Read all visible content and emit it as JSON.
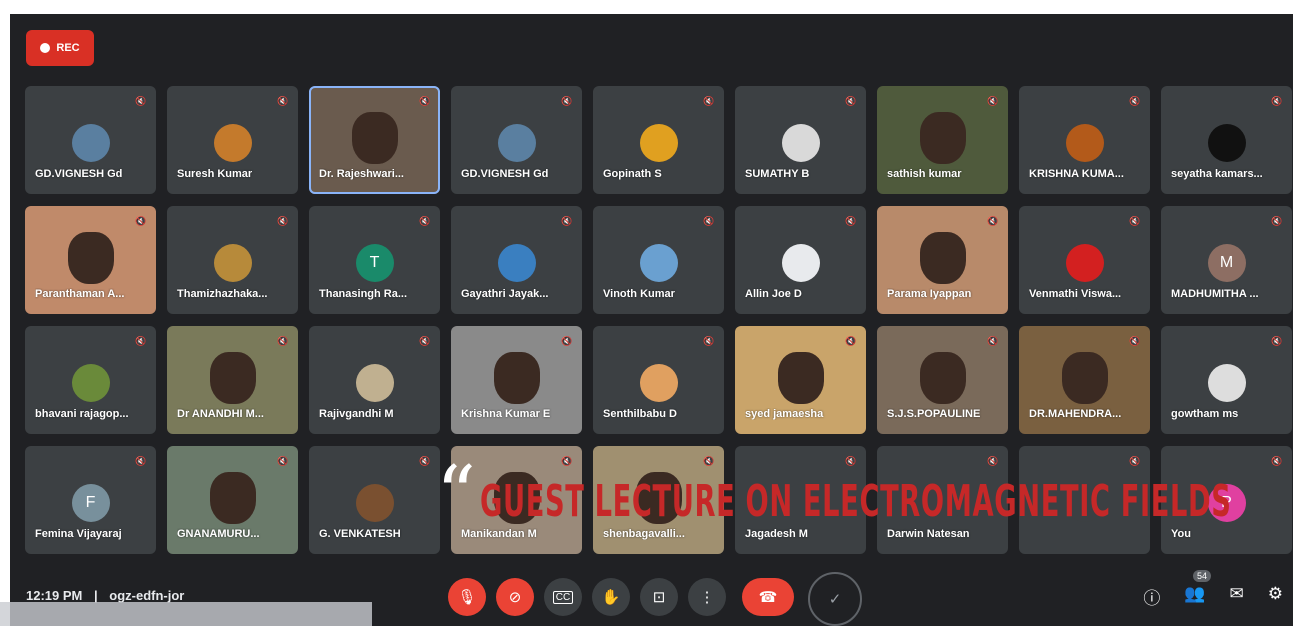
{
  "recording": {
    "label": "REC"
  },
  "tiles": [
    {
      "name": "GD.VIGNESH Gd",
      "type": "avatar",
      "initial": "",
      "color": "#5a7fa0"
    },
    {
      "name": "Suresh Kumar",
      "type": "avatar",
      "initial": "",
      "color": "#c47a2c"
    },
    {
      "name": "Dr. Rajeshwari...",
      "type": "video",
      "initial": "",
      "color": "#6a5b4e",
      "active": true
    },
    {
      "name": "GD.VIGNESH Gd",
      "type": "avatar",
      "initial": "",
      "color": "#5a7fa0"
    },
    {
      "name": "Gopinath S",
      "type": "avatar",
      "initial": "",
      "color": "#e0a020"
    },
    {
      "name": "SUMATHY B",
      "type": "avatar",
      "initial": "",
      "color": "#d9d9d9"
    },
    {
      "name": "sathish kumar",
      "type": "video",
      "initial": "",
      "color": "#4f5a3c"
    },
    {
      "name": "KRISHNA KUMA...",
      "type": "avatar",
      "initial": "",
      "color": "#b35a1a"
    },
    {
      "name": "seyatha kamars...",
      "type": "avatar",
      "initial": "",
      "color": "#111111"
    },
    {
      "name": "Paranthaman A...",
      "type": "video",
      "initial": "",
      "color": "#c08a6a"
    },
    {
      "name": "Thamizhazhaka...",
      "type": "avatar",
      "initial": "",
      "color": "#b78a3a"
    },
    {
      "name": "Thanasingh Ra...",
      "type": "avatar",
      "initial": "T",
      "color": "#1a8a6a"
    },
    {
      "name": "Gayathri Jayak...",
      "type": "avatar",
      "initial": "",
      "color": "#3a7fc0"
    },
    {
      "name": "Vinoth Kumar",
      "type": "avatar",
      "initial": "",
      "color": "#6aa0d0"
    },
    {
      "name": "Allin Joe D",
      "type": "avatar",
      "initial": "",
      "color": "#e8eaed"
    },
    {
      "name": "Parama Iyappan",
      "type": "video",
      "initial": "",
      "color": "#b88a6a"
    },
    {
      "name": "Venmathi Viswa...",
      "type": "avatar",
      "initial": "",
      "color": "#d32020"
    },
    {
      "name": "MADHUMITHA ...",
      "type": "avatar",
      "initial": "M",
      "color": "#8d6e63"
    },
    {
      "name": "bhavani rajagop...",
      "type": "avatar",
      "initial": "",
      "color": "#6a8a3a"
    },
    {
      "name": "Dr ANANDHI M...",
      "type": "video",
      "initial": "",
      "color": "#7a7a5a"
    },
    {
      "name": "Rajivgandhi M",
      "type": "avatar",
      "initial": "",
      "color": "#c0b090"
    },
    {
      "name": "Krishna Kumar E",
      "type": "video",
      "initial": "",
      "color": "#8a8a8a"
    },
    {
      "name": "Senthilbabu D",
      "type": "avatar",
      "initial": "",
      "color": "#e0a060"
    },
    {
      "name": "syed jamaesha",
      "type": "video",
      "initial": "",
      "color": "#c9a46a"
    },
    {
      "name": "S.J.S.POPAULINE",
      "type": "video",
      "initial": "",
      "color": "#7a6a5a"
    },
    {
      "name": "DR.MAHENDRA...",
      "type": "video",
      "initial": "",
      "color": "#7a6040"
    },
    {
      "name": "gowtham ms",
      "type": "avatar",
      "initial": "",
      "color": "#dddddd"
    },
    {
      "name": "Femina Vijayaraj",
      "type": "avatar",
      "initial": "F",
      "color": "#78909c"
    },
    {
      "name": "GNANAMURU...",
      "type": "video",
      "initial": "",
      "color": "#6a7a6a"
    },
    {
      "name": "G. VENKATESH",
      "type": "avatar",
      "initial": "",
      "color": "#7a5030"
    },
    {
      "name": "Manikandan M",
      "type": "video",
      "initial": "",
      "color": "#9a8a7a"
    },
    {
      "name": "shenbagavalli...",
      "type": "video",
      "initial": "",
      "color": "#a09070"
    },
    {
      "name": "Jagadesh M",
      "type": "avatar",
      "initial": "",
      "color": "#3c4043"
    },
    {
      "name": "Darwin Natesan",
      "type": "avatar",
      "initial": "",
      "color": "#3c4043"
    },
    {
      "name": "",
      "type": "avatar",
      "initial": "",
      "color": "#3c4043"
    },
    {
      "name": "You",
      "type": "avatar",
      "initial": "P",
      "color": "#e040a0"
    }
  ],
  "bottom": {
    "time": "12:19 PM",
    "separator": "|",
    "code": "ogz-edfn-jor",
    "participants_count": "54"
  },
  "overlay": {
    "quote": "“",
    "title": "GUEST LECTURE ON ELECTROMAGNETIC FIELDS"
  },
  "icons": {
    "mic": "mic-off-icon",
    "cam": "camera-off-icon",
    "cc": "captions-icon",
    "hand": "raise-hand-icon",
    "present": "present-icon",
    "more": "more-icon",
    "end": "end-call-icon",
    "info": "info-icon",
    "people": "people-icon",
    "chat": "chat-icon",
    "activities": "activities-icon"
  }
}
